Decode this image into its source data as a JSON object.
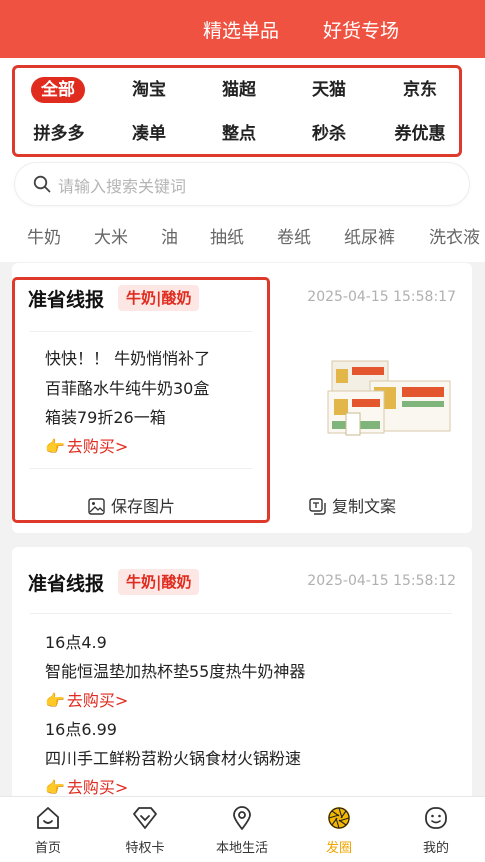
{
  "header": {
    "tabs": [
      "精选单品",
      "好货专场"
    ]
  },
  "categories": {
    "row1": [
      "全部",
      "淘宝",
      "猫超",
      "天猫",
      "京东"
    ],
    "row2": [
      "拼多多",
      "凑单",
      "整点",
      "秒杀",
      "券优惠"
    ],
    "active": "全部"
  },
  "search": {
    "placeholder": "请输入搜索关键词"
  },
  "keywords": [
    "牛奶",
    "大米",
    "油",
    "抽纸",
    "卷纸",
    "纸尿裤",
    "洗衣液"
  ],
  "posts": [
    {
      "title": "准省线报",
      "tag": "牛奶|酸奶",
      "timestamp": "2025-04-15 15:58:17",
      "lines": [
        "快快！！ 牛奶悄悄补了",
        "百菲酪水牛纯牛奶30盒",
        "箱装79折26一箱"
      ],
      "buy_label": "去购买>",
      "actions": {
        "save": "保存图片",
        "copy": "复制文案"
      }
    },
    {
      "title": "准省线报",
      "tag": "牛奶|酸奶",
      "timestamp": "2025-04-15 15:58:12",
      "lines": [
        "16点4.9",
        "智能恒温垫加热杯垫55度热牛奶神器",
        "16点6.99",
        "四川手工鲜粉苕粉火锅食材火锅粉速"
      ],
      "buy_label": "去购买>"
    }
  ],
  "bottom_nav": [
    {
      "label": "首页",
      "icon": "home-icon"
    },
    {
      "label": "特权卡",
      "icon": "diamond-icon"
    },
    {
      "label": "本地生活",
      "icon": "location-pin-icon"
    },
    {
      "label": "发圈",
      "icon": "aperture-icon"
    },
    {
      "label": "我的",
      "icon": "smiley-icon"
    }
  ],
  "colors": {
    "header_bg": "#ef5240",
    "accent_red": "#e02b1f",
    "highlight_box": "#dd3a2c",
    "nav_active": "#f0a500"
  }
}
